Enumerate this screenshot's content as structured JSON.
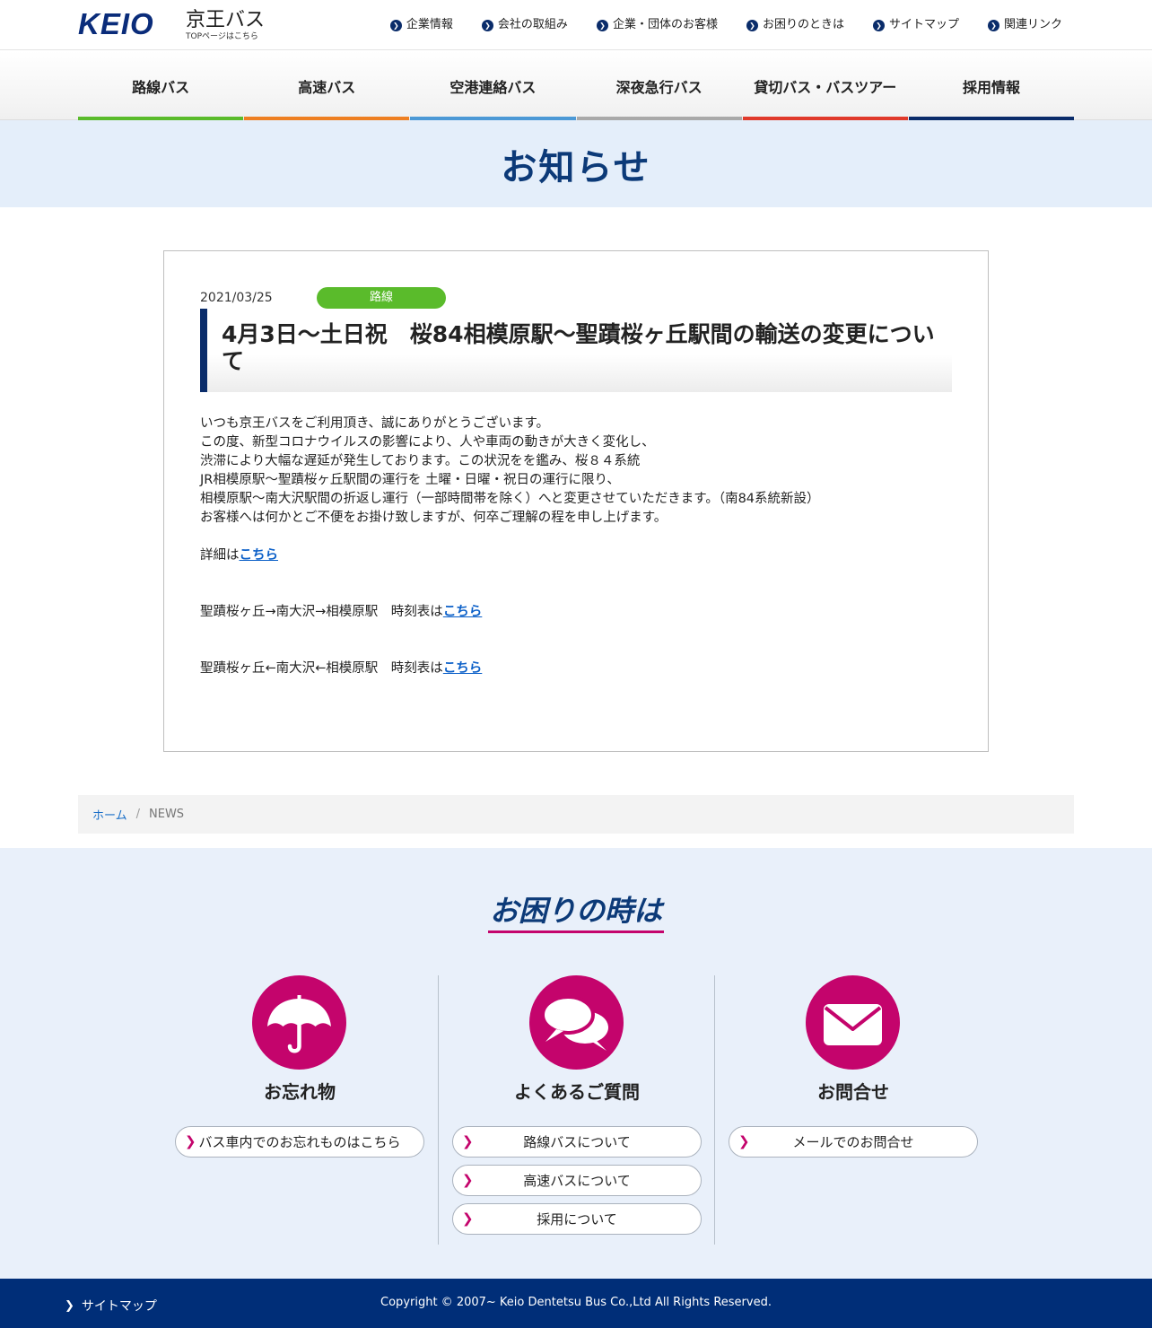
{
  "header": {
    "logo_mark": "KEIO",
    "logo_name": "京王バス",
    "logo_sub": "TOPページはこちら",
    "utility_links": [
      "企業情報",
      "会社の取組み",
      "企業・団体のお客様",
      "お困りのときは",
      "サイトマップ",
      "関連リンク"
    ]
  },
  "global_nav": [
    {
      "label": "路線バス",
      "color": "#5abb2b"
    },
    {
      "label": "高速バス",
      "color": "#ee7f22"
    },
    {
      "label": "空港連絡バス",
      "color": "#4c99d6"
    },
    {
      "label": "深夜急行バス",
      "color": "#a9a9a9"
    },
    {
      "label": "貸切バス・バスツアー",
      "color": "#e03a2b"
    },
    {
      "label": "採用情報",
      "color": "#0a2c6a"
    }
  ],
  "page_title": "お知らせ",
  "article": {
    "date": "2021/03/25",
    "category": "路線",
    "title": "4月3日〜土日祝　桜84相模原駅〜聖蹟桜ヶ丘駅間の輸送の変更について",
    "paragraph": [
      "いつも京王バスをご利用頂き、誠にありがとうございます。",
      "この度、新型コロナウイルスの影響により、人や車両の動きが大きく変化し、",
      "渋滞により大幅な遅延が発生しております。この状況をを鑑み、桜８４系統",
      "JR相模原駅〜聖蹟桜ヶ丘駅間の運行を 土曜・日曜・祝日の運行に限り、",
      "相模原駅〜南大沢駅間の折返し運行（一部時間帯を除く）へと変更させていただきます。（南84系統新設）",
      "お客様へは何かとご不便をお掛け致しますが、何卒ご理解の程を申し上げます。"
    ],
    "detail_prefix": "詳細は",
    "detail_link": "こちら",
    "timetable1_prefix": "聖蹟桜ヶ丘→南大沢→相模原駅　時刻表は",
    "timetable1_link": "こちら",
    "timetable2_prefix": "聖蹟桜ヶ丘←南大沢←相模原駅　時刻表は",
    "timetable2_link": "こちら"
  },
  "breadcrumb": {
    "home": "ホーム",
    "separator": "/",
    "current": "NEWS"
  },
  "help": {
    "title": "お困りの時は",
    "columns": [
      {
        "icon": "umbrella-icon",
        "title": "お忘れ物",
        "links": [
          "バス車内でのお忘れものはこちら"
        ]
      },
      {
        "icon": "chat-bubbles-icon",
        "title": "よくあるご質問",
        "links": [
          "路線バスについて",
          "高速バスについて",
          "採用について"
        ]
      },
      {
        "icon": "envelope-icon",
        "title": "お問合せ",
        "links": [
          "メールでのお問合せ"
        ]
      }
    ]
  },
  "footer": {
    "sitemap": "サイトマップ",
    "copyright": "Copyright © 2007~ Keio Dentetsu Bus Co.,Ltd All Rights Reserved."
  },
  "colors": {
    "brand_navy": "#0a2c6a",
    "accent_magenta": "#c4046c",
    "route_green": "#5abb2b"
  }
}
